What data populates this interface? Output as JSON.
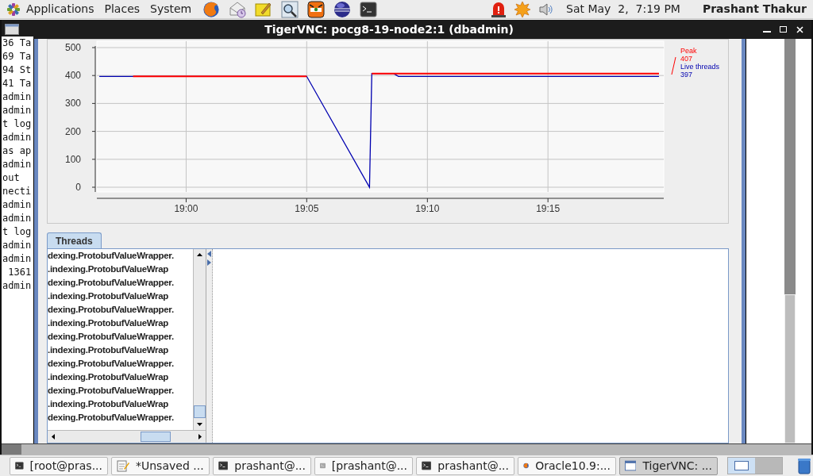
{
  "top_panel": {
    "menus": [
      "Applications",
      "Places",
      "System"
    ],
    "clock": "Sat May  2,  7:19 PM",
    "user": "Prashant Thakur"
  },
  "window": {
    "title": "TigerVNC: pocg8-19-node2:1 (dbadmin)"
  },
  "terminal_lines": [
    "36 Ta",
    "69 Ta",
    "94 St",
    "41 Ta",
    "admin",
    "admin",
    "t log",
    "admin",
    "as ap",
    "admin",
    "out",
    "necti",
    "admin",
    "admin",
    "t log",
    "admin",
    "admin",
    " 1361",
    "admin"
  ],
  "chart": {
    "legend": [
      {
        "value": "407"
      },
      {
        "value": "397"
      }
    ],
    "chart_data": {
      "type": "line",
      "x": [
        18.94,
        18.9633,
        19.0833,
        19.1267,
        19.1283,
        19.1433,
        19.1467,
        19.3267
      ],
      "series": [
        {
          "name": "Peak",
          "color": "#ff0000",
          "values": [
            null,
            397,
            397,
            null,
            407,
            407,
            407,
            407
          ]
        },
        {
          "name": "Live threads",
          "color": "#0000b0",
          "values": [
            397,
            397,
            397,
            0,
            407,
            407,
            397,
            397
          ]
        }
      ],
      "grid": true,
      "xlim": [
        18.9383,
        19.33
      ],
      "ylim": [
        0,
        500
      ],
      "xticks": [
        {
          "value": 19,
          "label": "19:00"
        },
        {
          "value": 19.0833,
          "label": "19:05"
        },
        {
          "value": 19.1667,
          "label": "19:10"
        },
        {
          "value": 19.25,
          "label": "19:15"
        }
      ],
      "yticks": [
        0,
        100,
        200,
        300,
        400,
        500
      ]
    }
  },
  "tabs": [
    {
      "label": "Threads",
      "selected": true
    }
  ],
  "thread_list": [
    "dexing.ProtobufValueWrapper.",
    ".indexing.ProtobufValueWrap",
    "dexing.ProtobufValueWrapper.",
    ".indexing.ProtobufValueWrap",
    "dexing.ProtobufValueWrapper.",
    ".indexing.ProtobufValueWrap",
    "dexing.ProtobufValueWrapper.",
    ".indexing.ProtobufValueWrap",
    "dexing.ProtobufValueWrapper.",
    ".indexing.ProtobufValueWrap",
    "dexing.ProtobufValueWrapper.",
    ".indexing.ProtobufValueWrap",
    "dexing.ProtobufValueWrapper."
  ],
  "taskbar": [
    {
      "label": "[root@pras...",
      "kind": "terminal",
      "selected": false
    },
    {
      "label": "*Unsaved ...",
      "kind": "editor",
      "selected": false
    },
    {
      "label": "prashant@...",
      "kind": "terminal",
      "selected": false
    },
    {
      "label": "[prashant@...",
      "kind": "terminal-idle",
      "selected": false
    },
    {
      "label": "prashant@...",
      "kind": "terminal",
      "selected": false
    },
    {
      "label": "Oracle10.9:...",
      "kind": "browser",
      "selected": false
    },
    {
      "label": "TigerVNC: ...",
      "kind": "window",
      "selected": true
    }
  ],
  "workspaces": [
    {
      "selected": true
    },
    {
      "selected": false
    }
  ]
}
